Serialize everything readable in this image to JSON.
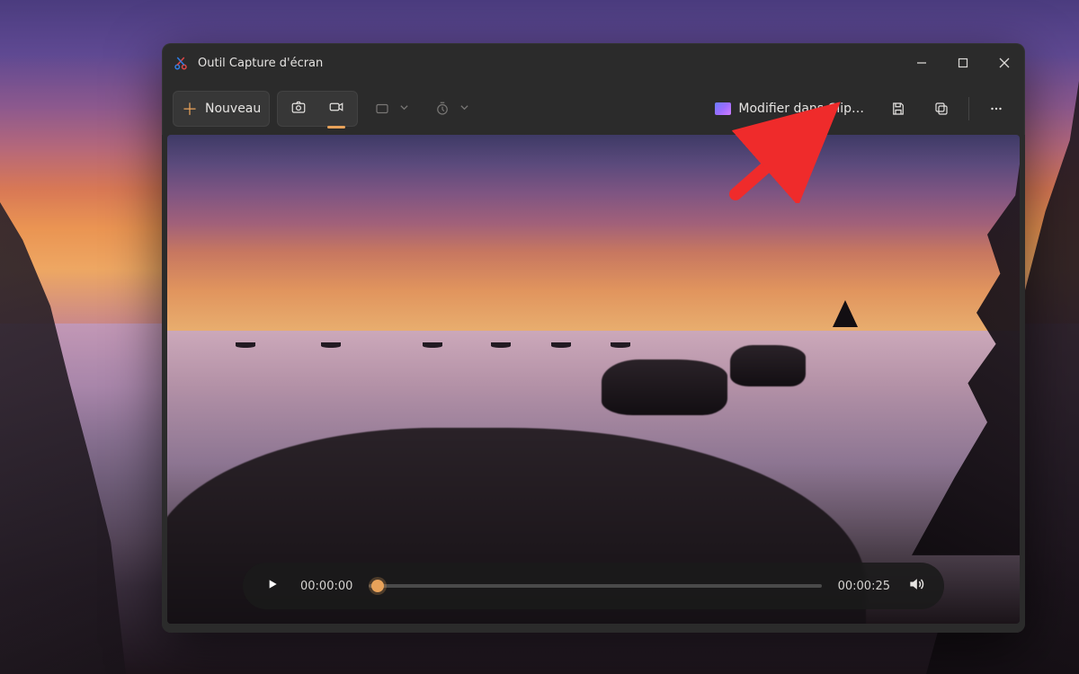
{
  "window": {
    "title": "Outil Capture d'écran"
  },
  "toolbar": {
    "new_label": "Nouveau",
    "edit_clipchamp_label": "Modifier dans Clip…"
  },
  "player": {
    "current_time": "00:00:00",
    "duration": "00:00:25"
  },
  "icons": {
    "app": "snipping-tool-icon",
    "minimize": "minimize-icon",
    "maximize": "maximize-icon",
    "close": "close-icon",
    "plus": "plus-icon",
    "camera": "camera-icon",
    "video": "video-icon",
    "shape": "capture-shape-icon",
    "timer": "timer-icon",
    "clipchamp": "clipchamp-icon",
    "save": "save-icon",
    "copy": "copy-icon",
    "more": "more-icon",
    "play": "play-icon",
    "volume": "volume-icon"
  },
  "colors": {
    "accent": "#e8a25a",
    "window_bg": "#2b2b2b",
    "arrow": "#ef2b2b"
  }
}
